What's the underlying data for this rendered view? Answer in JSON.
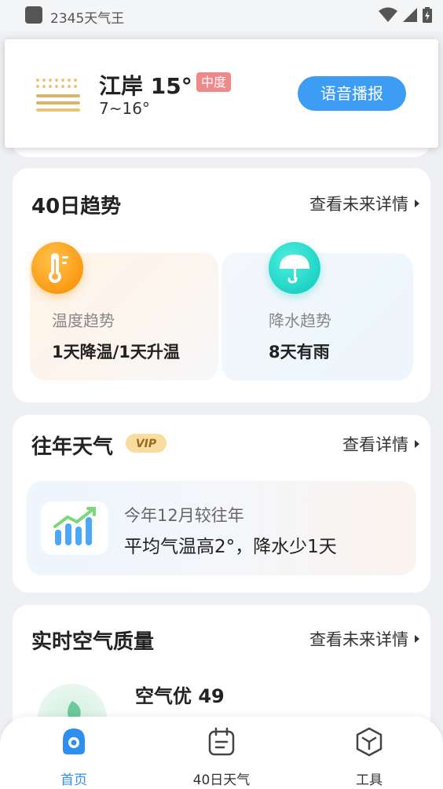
{
  "status_bar": {
    "app_name": "2345天气王",
    "icons": [
      "wifi-icon",
      "signal-icon",
      "battery-icon"
    ]
  },
  "header": {
    "location_temp": "江岸 15°",
    "air_quality_badge": "中度",
    "temp_range": "7~16°",
    "voice_button": "语音播报",
    "weather_icon": "haze-icon"
  },
  "trend_card": {
    "title": "40日趋势",
    "more_link": "查看未来详情",
    "items": [
      {
        "icon": "thermometer-icon",
        "label": "温度趋势",
        "value": "1天降温/1天升温"
      },
      {
        "icon": "umbrella-icon",
        "label": "降水趋势",
        "value": "8天有雨"
      }
    ]
  },
  "history_card": {
    "title": "往年天气",
    "vip": "VIP",
    "more_link": "查看详情",
    "subtitle": "今年12月较往年",
    "summary": "平均气温高2°，降水少1天",
    "icon": "bar-chart-icon"
  },
  "air_card": {
    "title": "实时空气质量",
    "more_link": "查看未来详情",
    "status": "空气优 49",
    "icon": "leaf-icon"
  },
  "bottom_nav": {
    "items": [
      {
        "label": "首页",
        "icon": "home-icon",
        "active": true
      },
      {
        "label": "40日天气",
        "icon": "calendar-icon",
        "active": false
      },
      {
        "label": "工具",
        "icon": "tools-icon",
        "active": false
      }
    ]
  },
  "colors": {
    "accent": "#3d9df5",
    "badge": "#f08a8a",
    "active_nav": "#2f8ff0",
    "temp_icon": "#fb9b14",
    "rain_icon": "#1fd3c6"
  }
}
